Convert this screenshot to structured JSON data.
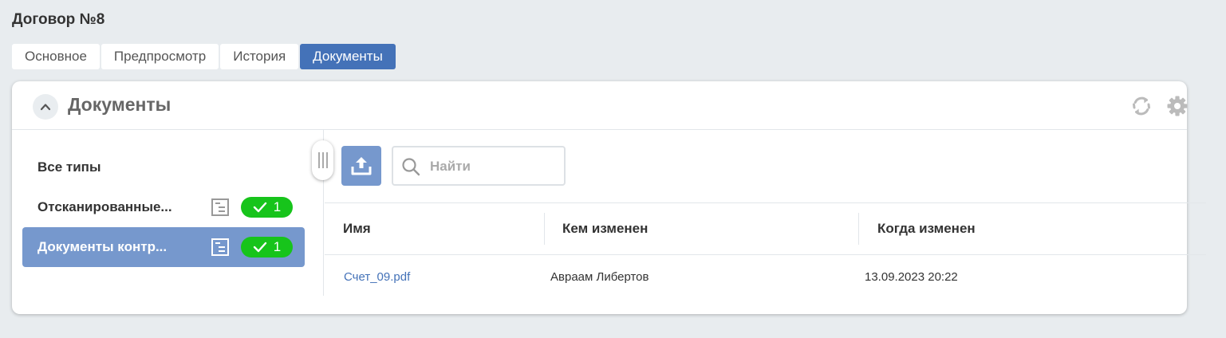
{
  "page": {
    "title": "Договор №8"
  },
  "tabs": [
    {
      "label": "Основное",
      "active": false
    },
    {
      "label": "Предпросмотр",
      "active": false
    },
    {
      "label": "История",
      "active": false
    },
    {
      "label": "Документы",
      "active": true
    }
  ],
  "panel": {
    "title": "Документы",
    "icons": [
      "chevron-up-icon",
      "refresh-icon",
      "gear-icon"
    ]
  },
  "types": {
    "all_label": "Все типы",
    "items": [
      {
        "label": "Отсканированные...",
        "count": "1",
        "active": false
      },
      {
        "label": "Документы контр...",
        "count": "1",
        "active": true
      }
    ]
  },
  "toolbar": {
    "upload_icon": "upload-icon",
    "search_placeholder": "Найти"
  },
  "table": {
    "columns": [
      "Имя",
      "Кем изменен",
      "Когда изменен"
    ],
    "rows": [
      {
        "name": "Счет_09.pdf",
        "modified_by": "Авраам Либертов",
        "modified_at": "13.09.2023 20:22"
      }
    ]
  },
  "colors": {
    "accent": "#4472b8",
    "selected": "#7698cd",
    "badge": "#17c41b",
    "background": "#e8ecef"
  }
}
